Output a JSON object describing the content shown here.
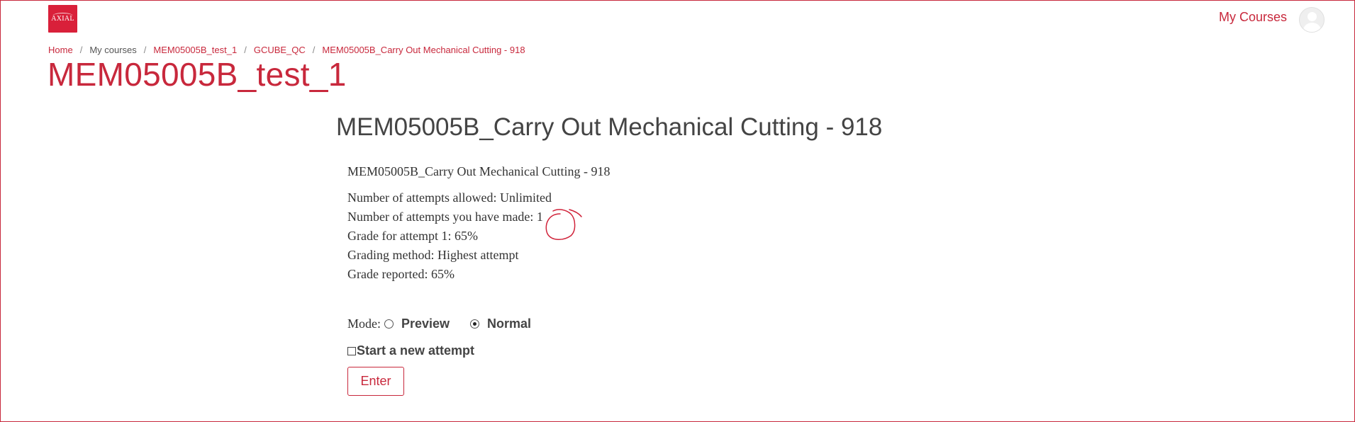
{
  "header": {
    "logo_text": "AXIAL",
    "my_courses": "My Courses"
  },
  "breadcrumb": [
    {
      "label": "Home"
    },
    {
      "label": "My courses"
    },
    {
      "label": "MEM05005B_test_1"
    },
    {
      "label": "GCUBE_QC"
    },
    {
      "label": "MEM05005B_Carry Out Mechanical Cutting - 918"
    }
  ],
  "course_title": "MEM05005B_test_1",
  "activity_title": "MEM05005B_Carry Out Mechanical Cutting - 918",
  "info": {
    "name": "MEM05005B_Carry Out Mechanical Cutting - 918",
    "lines": [
      "Number of attempts allowed: Unlimited",
      "Number of attempts you have made: 1",
      "Grade for attempt 1: 65%",
      "Grading method: Highest attempt",
      "Grade reported: 65%"
    ]
  },
  "mode": {
    "label": "Mode:",
    "options": [
      "Preview",
      "Normal"
    ],
    "selected": "Normal"
  },
  "start_new_attempt": "Start a new attempt",
  "enter_button": "Enter",
  "colors": {
    "accent": "#c8283c"
  }
}
